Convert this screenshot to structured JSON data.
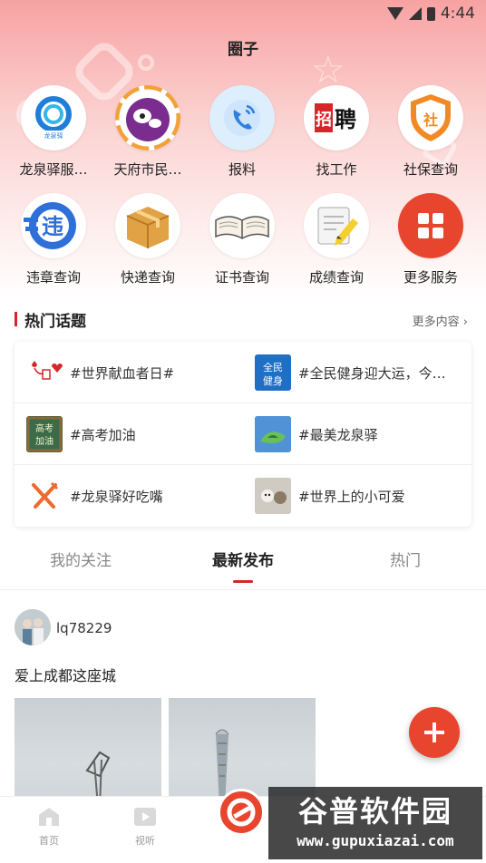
{
  "status_bar": {
    "time": "4:44"
  },
  "header": {
    "title": "圈子"
  },
  "services": [
    {
      "label": "龙泉驿服…",
      "icon": "longquanyi-logo-icon"
    },
    {
      "label": "天府市民…",
      "icon": "tianfu-citizen-icon"
    },
    {
      "label": "报料",
      "icon": "phone-report-icon"
    },
    {
      "label": "找工作",
      "icon": "job-recruit-icon"
    },
    {
      "label": "社保查询",
      "icon": "social-security-shield-icon"
    },
    {
      "label": "违章查询",
      "icon": "traffic-violation-icon"
    },
    {
      "label": "快递查询",
      "icon": "parcel-box-icon"
    },
    {
      "label": "证书查询",
      "icon": "open-book-icon"
    },
    {
      "label": "成绩查询",
      "icon": "notepad-pen-icon"
    },
    {
      "label": "更多服务",
      "icon": "grid-more-icon"
    }
  ],
  "hot_topics": {
    "title": "热门话题",
    "more": "更多内容",
    "items": [
      {
        "text": "#世界献血者日#",
        "thumb": "blood-donation-icon"
      },
      {
        "text": "#全民健身迎大运，今…",
        "thumb": "fitness-badge-icon"
      },
      {
        "text": "#高考加油",
        "thumb": "exam-chalkboard-icon"
      },
      {
        "text": "#最美龙泉驿",
        "thumb": "landscape-icon"
      },
      {
        "text": "#龙泉驿好吃嘴",
        "thumb": "fork-knife-icon"
      },
      {
        "text": "#世界上的小可爱",
        "thumb": "cute-pet-icon"
      }
    ]
  },
  "feed_tabs": [
    {
      "label": "我的关注",
      "active": false
    },
    {
      "label": "最新发布",
      "active": true
    },
    {
      "label": "热门",
      "active": false
    }
  ],
  "post": {
    "username": "lq78229",
    "text": "爱上成都这座城"
  },
  "bottom_nav": [
    {
      "label": "首页",
      "icon": "home-icon"
    },
    {
      "label": "视听",
      "icon": "video-play-icon"
    }
  ],
  "watermark": {
    "title": "谷普软件园",
    "url": "www.gupuxiazai.com"
  },
  "colors": {
    "accent": "#d6262b",
    "fab": "#e8452f",
    "hero_top": "#f7a2a2"
  }
}
